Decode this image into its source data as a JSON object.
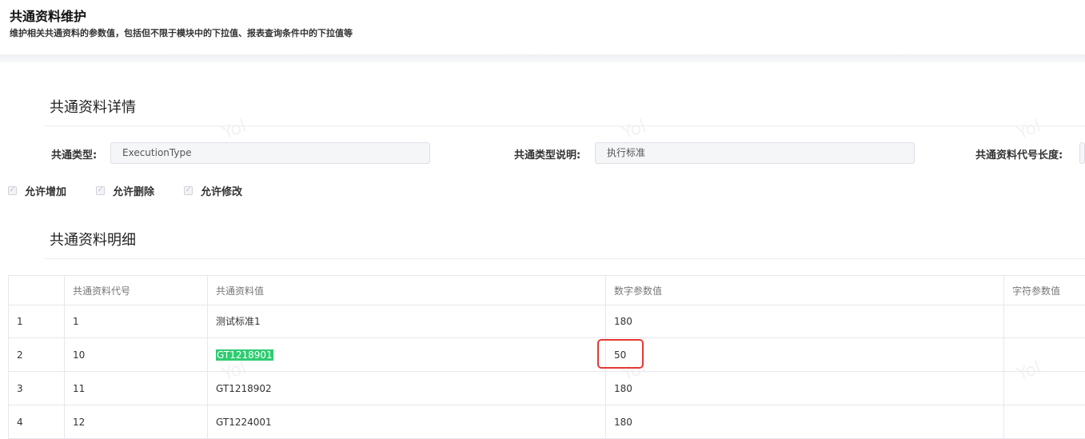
{
  "header": {
    "title": "共通资料维护",
    "description": "维护相关共通资料的参数值，包括但不限于模块中的下拉值、报表查询条件中的下拉值等"
  },
  "watermark": "Yol",
  "detail": {
    "section_title": "共通资料详情",
    "fields": [
      {
        "label": "共通类型:",
        "value": "ExecutionType"
      },
      {
        "label": "共通类型说明:",
        "value": "执行标准"
      },
      {
        "label": "共通资料代号长度:",
        "value": ""
      }
    ],
    "checkboxes": [
      {
        "label": "允许增加",
        "checked": true
      },
      {
        "label": "允许删除",
        "checked": true
      },
      {
        "label": "允许修改",
        "checked": true
      }
    ]
  },
  "list": {
    "section_title": "共通资料明细",
    "columns": [
      "",
      "共通资料代号",
      "共通资料值",
      "数字参数值",
      "字符参数值"
    ],
    "rows": [
      {
        "index": "1",
        "code": "1",
        "value": "测试标准1",
        "num": "180",
        "str": ""
      },
      {
        "index": "2",
        "code": "10",
        "value": "GT1218901",
        "num": "50",
        "str": ""
      },
      {
        "index": "3",
        "code": "11",
        "value": "GT1218902",
        "num": "180",
        "str": ""
      },
      {
        "index": "4",
        "code": "12",
        "value": "GT1224001",
        "num": "180",
        "str": ""
      }
    ]
  },
  "colors": {
    "highlight": "#2ecc71",
    "annotation": "#e53935"
  }
}
